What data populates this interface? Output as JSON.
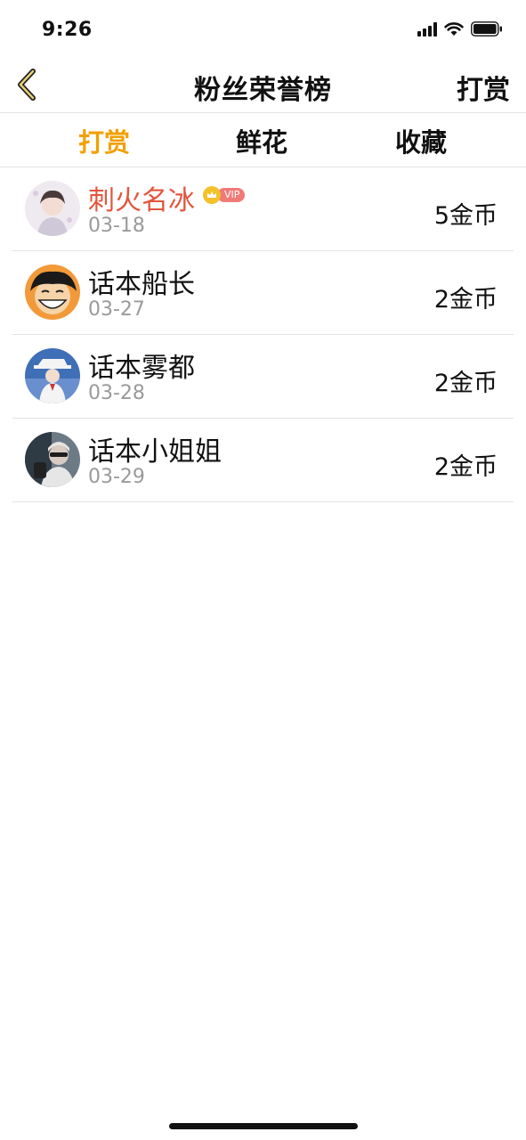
{
  "status_bar": {
    "time": "9:26"
  },
  "nav": {
    "title": "粉丝荣誉榜",
    "right_label": "打赏",
    "back_icon": "chevron-left-icon"
  },
  "tabs": [
    {
      "label": "打赏",
      "active": true
    },
    {
      "label": "鲜花",
      "active": false
    },
    {
      "label": "收藏",
      "active": false
    }
  ],
  "vip_badge": {
    "label": "VIP"
  },
  "list": [
    {
      "name": "刺火名冰",
      "date": "03-18",
      "amount": "5金币",
      "vip": true
    },
    {
      "name": "话本船长",
      "date": "03-27",
      "amount": "2金币",
      "vip": false
    },
    {
      "name": "话本雾都",
      "date": "03-28",
      "amount": "2金币",
      "vip": false
    },
    {
      "name": "话本小姐姐",
      "date": "03-29",
      "amount": "2金币",
      "vip": false
    }
  ],
  "colors": {
    "accent": "#f2a000",
    "vip_name": "#e2553d",
    "vip_badge": "#f07a78",
    "crown": "#f5c12a",
    "date": "#9a9a9a",
    "divider": "#e3e3e3"
  }
}
